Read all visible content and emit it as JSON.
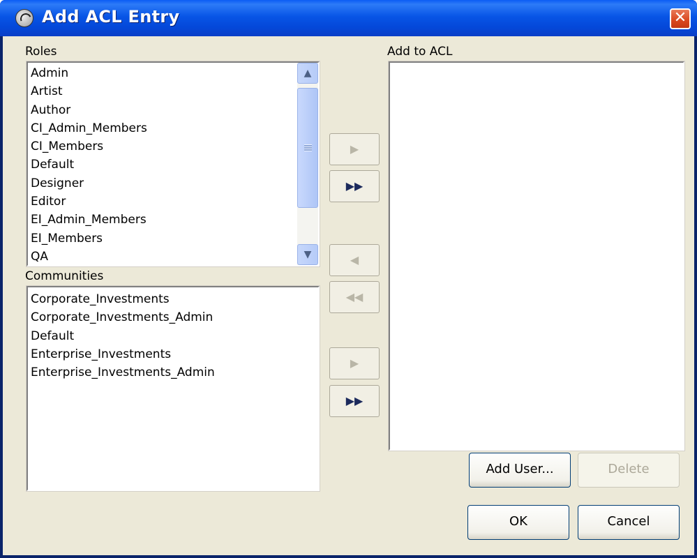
{
  "window": {
    "title": "Add ACL Entry",
    "close_symbol": "✕"
  },
  "roles": {
    "label": "Roles",
    "items": [
      "Admin",
      "Artist",
      "Author",
      "CI_Admin_Members",
      "CI_Members",
      "Default",
      "Designer",
      "Editor",
      "EI_Admin_Members",
      "EI_Members",
      "QA"
    ],
    "scroll_up": "▲",
    "scroll_down": "▼"
  },
  "communities": {
    "label": "Communities",
    "items": [
      "Corporate_Investments",
      "Corporate_Investments_Admin",
      "Default",
      "Enterprise_Investments",
      "Enterprise_Investments_Admin"
    ]
  },
  "acl": {
    "label": "Add to ACL",
    "items": []
  },
  "move_buttons": {
    "add_role": "▶",
    "add_all_roles": "▶▶",
    "remove": "◀",
    "remove_all": "◀◀",
    "add_community": "▶",
    "add_all_communities": "▶▶"
  },
  "buttons": {
    "add_user": "Add User...",
    "delete": "Delete",
    "ok": "OK",
    "cancel": "Cancel"
  }
}
